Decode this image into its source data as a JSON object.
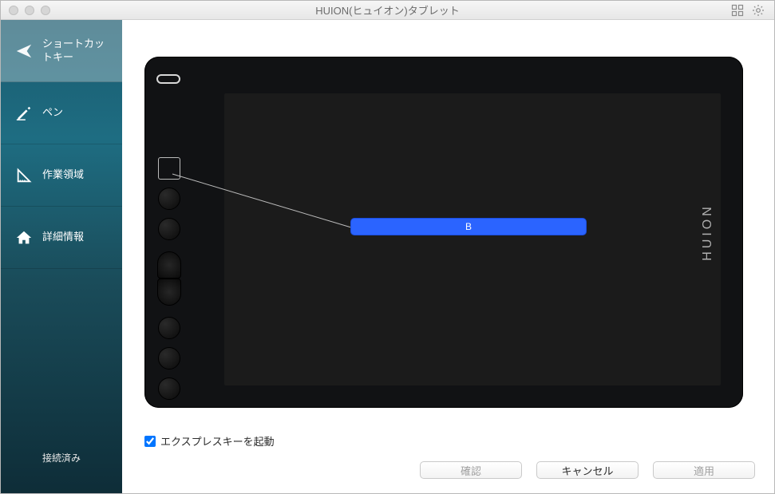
{
  "window": {
    "title": "HUION(ヒュイオン)タブレット"
  },
  "sidebar": {
    "items": [
      {
        "label": "ショートカットキー"
      },
      {
        "label": "ペン"
      },
      {
        "label": "作業領域"
      },
      {
        "label": "詳細情報"
      }
    ],
    "status": "接続済み"
  },
  "tablet": {
    "brand": "HUION",
    "selected_key_label": "B"
  },
  "options": {
    "enable_express_keys_label": "エクスプレスキーを起動",
    "enable_express_keys_checked": true
  },
  "buttons": {
    "ok": "確認",
    "cancel": "キャンセル",
    "apply": "適用"
  }
}
